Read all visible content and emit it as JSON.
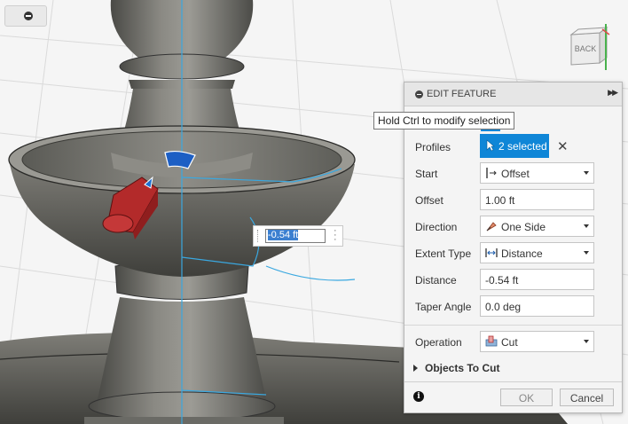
{
  "viewport": {
    "dimension_value": "-0.54 ft",
    "viewcube_label": "BACK",
    "model_fill": "#6b6b66",
    "highlight": "#2b9fd8",
    "cut_tool_color": "#c0392b"
  },
  "tooltip": "Hold Ctrl to modify selection",
  "panel": {
    "title": "EDIT FEATURE",
    "expand_icon": "double-chevron-right",
    "rows": {
      "profiles": {
        "label": "Profiles",
        "value": "2 selected",
        "clear_icon": "✕"
      },
      "start": {
        "label": "Start",
        "value": "Offset",
        "icon": "offset-start-icon"
      },
      "offset": {
        "label": "Offset",
        "value": "1.00 ft"
      },
      "direction": {
        "label": "Direction",
        "value": "One Side",
        "icon": "one-side-icon"
      },
      "extent_type": {
        "label": "Extent Type",
        "value": "Distance",
        "icon": "distance-icon"
      },
      "distance": {
        "label": "Distance",
        "value": "-0.54 ft"
      },
      "taper_angle": {
        "label": "Taper Angle",
        "value": "0.0 deg"
      },
      "operation": {
        "label": "Operation",
        "value": "Cut",
        "icon": "cut-icon"
      }
    },
    "objects_to_cut": "Objects To Cut",
    "ok": "OK",
    "cancel": "Cancel",
    "accent_color": "#0f86d7"
  }
}
